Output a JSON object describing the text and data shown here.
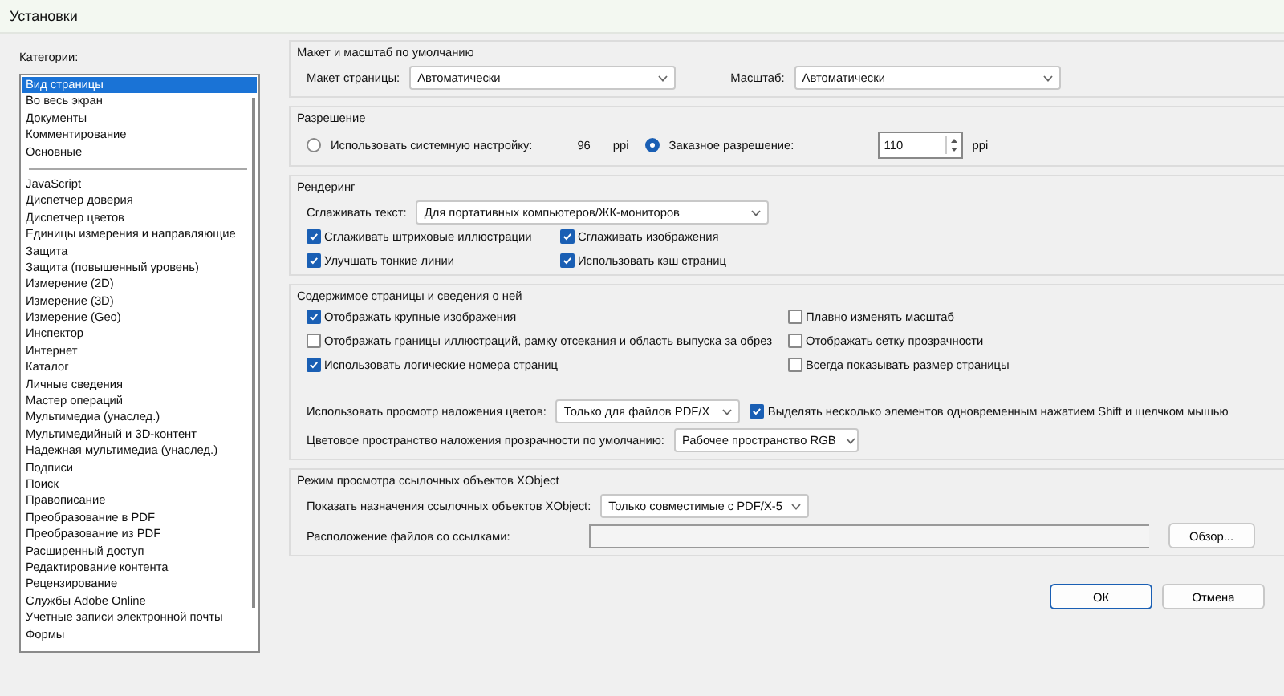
{
  "window": {
    "title": "Установки"
  },
  "categories": {
    "label": "Категории:",
    "groups": [
      [
        {
          "label": "Вид страницы",
          "selected": true
        },
        {
          "label": "Во весь экран",
          "selected": false
        },
        {
          "label": "Документы",
          "selected": false
        },
        {
          "label": "Комментирование",
          "selected": false
        },
        {
          "label": "Основные",
          "selected": false
        }
      ],
      [
        {
          "label": "JavaScript",
          "selected": false
        },
        {
          "label": "Диспетчер доверия",
          "selected": false
        },
        {
          "label": "Диспетчер цветов",
          "selected": false
        },
        {
          "label": "Единицы измерения и направляющие",
          "selected": false
        },
        {
          "label": "Защита",
          "selected": false
        },
        {
          "label": "Защита (повышенный уровень)",
          "selected": false
        },
        {
          "label": "Измерение (2D)",
          "selected": false
        },
        {
          "label": "Измерение (3D)",
          "selected": false
        },
        {
          "label": "Измерение (Geo)",
          "selected": false
        },
        {
          "label": "Инспектор",
          "selected": false
        },
        {
          "label": "Интернет",
          "selected": false
        },
        {
          "label": "Каталог",
          "selected": false
        },
        {
          "label": "Личные сведения",
          "selected": false
        },
        {
          "label": "Мастер операций",
          "selected": false
        },
        {
          "label": "Мультимедиа (унаслед.)",
          "selected": false
        },
        {
          "label": "Мультимедийный и 3D-контент",
          "selected": false
        },
        {
          "label": "Надежная мультимедиа (унаслед.)",
          "selected": false
        },
        {
          "label": "Подписи",
          "selected": false
        },
        {
          "label": "Поиск",
          "selected": false
        },
        {
          "label": "Правописание",
          "selected": false
        },
        {
          "label": "Преобразование в PDF",
          "selected": false
        },
        {
          "label": "Преобразование из PDF",
          "selected": false
        },
        {
          "label": "Расширенный доступ",
          "selected": false
        },
        {
          "label": "Редактирование контента",
          "selected": false
        },
        {
          "label": "Рецензирование",
          "selected": false
        },
        {
          "label": "Службы Adobe Online",
          "selected": false
        },
        {
          "label": "Учетные записи электронной почты",
          "selected": false
        },
        {
          "label": "Формы",
          "selected": false
        }
      ]
    ]
  },
  "layout_zoom": {
    "title": "Макет и масштаб по умолчанию",
    "page_layout": {
      "label": "Макет страницы:",
      "value": "Автоматически"
    },
    "zoom": {
      "label": "Масштаб:",
      "value": "Автоматически"
    }
  },
  "resolution": {
    "title": "Разрешение",
    "system": {
      "label": "Использовать системную настройку:",
      "selected": false,
      "value": "96",
      "unit": "ppi"
    },
    "custom": {
      "label": "Заказное разрешение:",
      "selected": true,
      "value": "110",
      "unit": "ppi"
    }
  },
  "rendering": {
    "title": "Рендеринг",
    "smooth_text": {
      "label": "Сглаживать текст:",
      "value": "Для портативных компьютеров/ЖК-мониторов"
    },
    "checkboxes": [
      {
        "label": "Сглаживать штриховые иллюстрации",
        "checked": true
      },
      {
        "label": "Сглаживать изображения",
        "checked": true
      },
      {
        "label": "Улучшать тонкие линии",
        "checked": true
      },
      {
        "label": "Использовать кэш страниц",
        "checked": true
      }
    ]
  },
  "page_content": {
    "title": "Содержимое страницы и сведения о ней",
    "checkboxes": [
      {
        "label": "Отображать крупные изображения",
        "checked": true
      },
      {
        "label": "Плавно изменять масштаб",
        "checked": false
      },
      {
        "label": "Отображать границы иллюстраций, рамку отсекания и область выпуска за обрез",
        "checked": false
      },
      {
        "label": "Отображать сетку прозрачности",
        "checked": false
      },
      {
        "label": "Использовать логические номера страниц",
        "checked": true
      },
      {
        "label": "Всегда показывать размер страницы",
        "checked": false
      }
    ],
    "overprint": {
      "label": "Использовать просмотр наложения цветов:",
      "value": "Только для файлов PDF/X"
    },
    "multi_select": {
      "label": "Выделять несколько элементов одновременным нажатием Shift и щелчком мышью",
      "checked": true
    },
    "blend_space": {
      "label": "Цветовое пространство наложения прозрачности по умолчанию:",
      "value": "Рабочее пространство RGB"
    }
  },
  "xobject": {
    "title": "Режим просмотра ссылочных объектов XObject",
    "show": {
      "label": "Показать назначения ссылочных объектов XObject:",
      "value": "Только совместимые с PDF/X-5"
    },
    "location": {
      "label": "Расположение файлов со ссылками:",
      "button": "Обзор..."
    }
  },
  "buttons": [
    "ОК",
    "Отмена"
  ]
}
